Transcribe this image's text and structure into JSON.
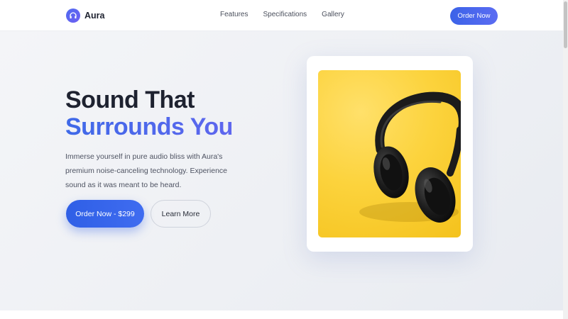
{
  "brand": {
    "name": "Aura",
    "logo_icon": "headphones-icon",
    "accent": "#4f6ff0"
  },
  "nav": {
    "links": [
      "Features",
      "Specifications",
      "Gallery"
    ],
    "cta_label": "Order Now"
  },
  "hero": {
    "headline_line1": "Sound That",
    "headline_line2": "Surrounds You",
    "subtext": "Immerse yourself in pure audio bliss with Aura's premium noise-canceling technology. Experience sound as it was meant to be heard.",
    "primary_button": "Order Now - $299",
    "secondary_button": "Learn More"
  },
  "product": {
    "image_subject": "black over-ear headphones on yellow background"
  },
  "colors": {
    "primary": "#3b63e8",
    "image_bg": "#fcd33d"
  }
}
